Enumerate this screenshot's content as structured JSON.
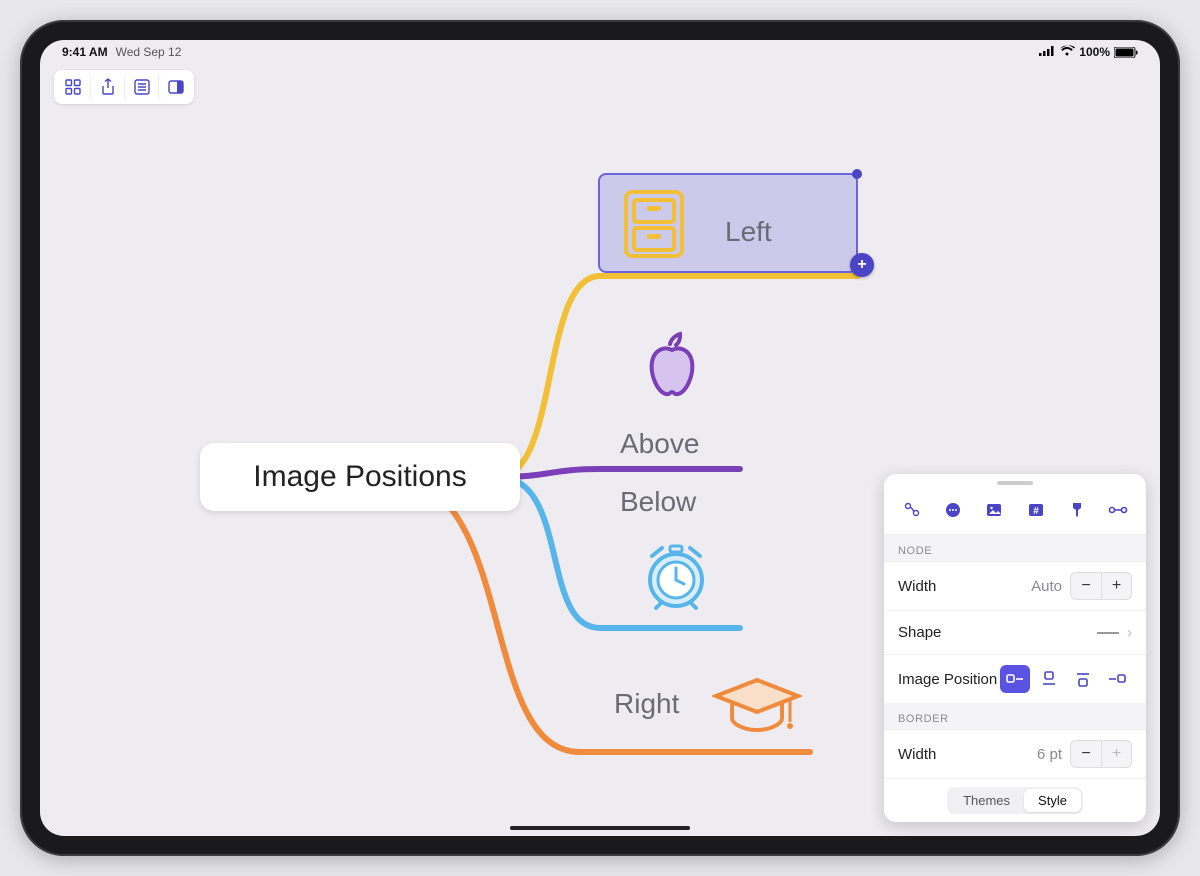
{
  "status": {
    "time": "9:41 AM",
    "date": "Wed Sep 12",
    "battery": "100%"
  },
  "canvas": {
    "root": "Image Positions",
    "nodes": {
      "left": "Left",
      "above": "Above",
      "below": "Below",
      "right": "Right"
    },
    "colors": {
      "branch_left": "#f2c037",
      "branch_above": "#7b3fb8",
      "branch_below": "#58b5ea",
      "branch_right": "#f08a3c",
      "selection": "#6b63e0",
      "accent": "#4a45c7"
    }
  },
  "inspector": {
    "sections": {
      "node": "NODE",
      "border": "BORDER"
    },
    "node": {
      "width_label": "Width",
      "width_value": "Auto",
      "shape_label": "Shape",
      "image_position_label": "Image Position"
    },
    "border": {
      "width_label": "Width",
      "width_value": "6 pt"
    },
    "tabs": {
      "themes": "Themes",
      "style": "Style"
    }
  }
}
